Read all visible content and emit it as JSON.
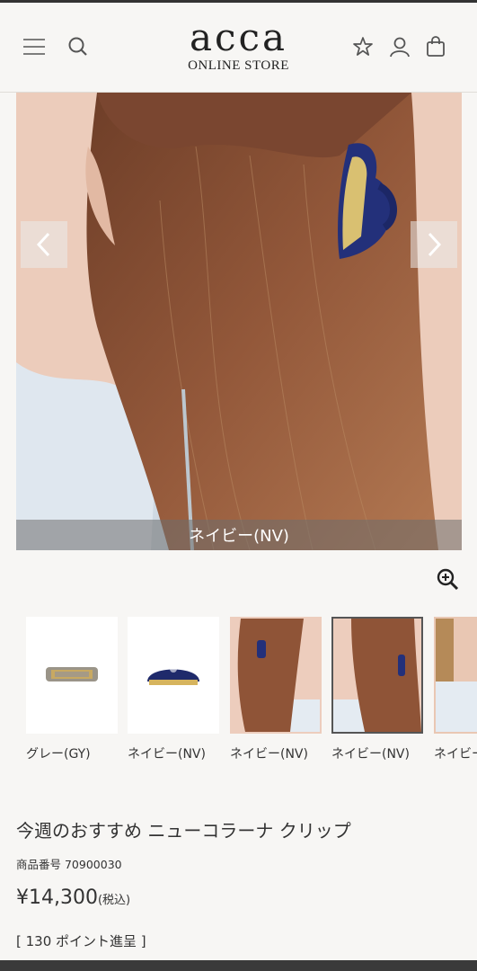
{
  "header": {
    "logo_main": "acca",
    "logo_sub": "ONLINE STORE",
    "icons": [
      "menu-icon",
      "search-icon",
      "star-icon",
      "user-icon",
      "bag-icon"
    ]
  },
  "hero": {
    "caption": "ネイビー(NV)",
    "colors": {
      "skin_bg": "#ecccbb",
      "hair": "#8a5236",
      "clip": "#23307a",
      "caption_bg": "#6e6e6e"
    }
  },
  "thumbnails": [
    {
      "label": "グレー(GY)",
      "selected": false
    },
    {
      "label": "ネイビー(NV)",
      "selected": false
    },
    {
      "label": "ネイビー(NV)",
      "selected": false
    },
    {
      "label": "ネイビー(NV)",
      "selected": true
    },
    {
      "label": "ネイビー(NV)",
      "selected": false
    }
  ],
  "product": {
    "title": "今週のおすすめ ニューコラーナ クリップ",
    "code": "商品番号 70900030",
    "price": "¥14,300",
    "tax": "(税込)",
    "points": "[ 130 ポイント進呈 ]"
  }
}
